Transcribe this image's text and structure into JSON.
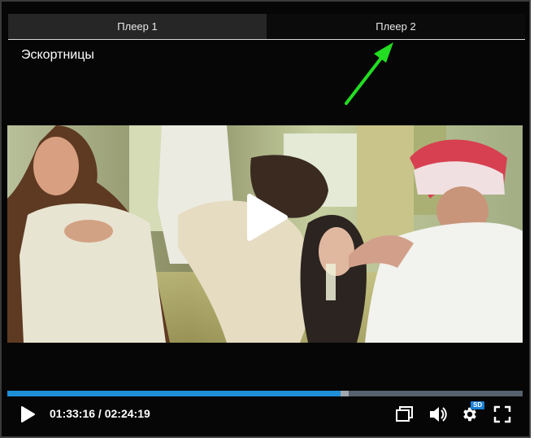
{
  "tabs": [
    {
      "label": "Плеер 1",
      "active": true
    },
    {
      "label": "Плеер 2",
      "active": false
    }
  ],
  "video": {
    "title": "Эскортницы"
  },
  "player": {
    "current_time": "01:33:16",
    "duration": "02:24:19",
    "time_separator": " / ",
    "progress_played": 0.647,
    "progress_buffered": 0.662,
    "quality_badge": "SD"
  },
  "colors": {
    "accent": "#1e8ed6",
    "annotation_arrow": "#22dd22",
    "background": "#060606"
  },
  "icons": [
    "play-icon",
    "miniplayer-icon",
    "volume-icon",
    "settings-gear-icon",
    "fullscreen-icon"
  ]
}
